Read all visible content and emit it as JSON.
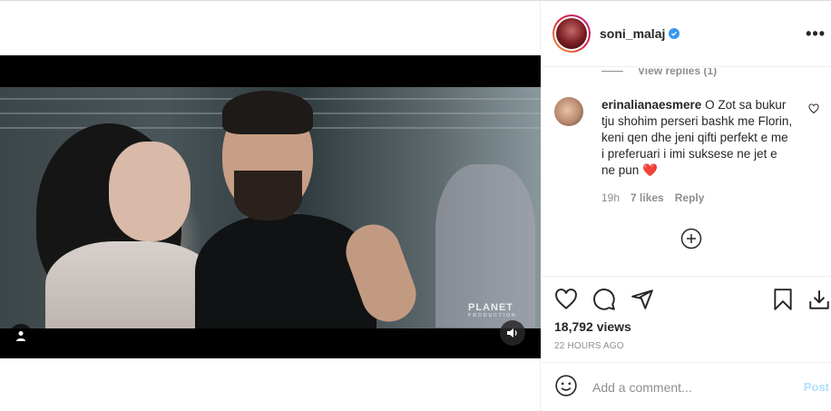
{
  "post": {
    "username": "soni_malaj",
    "verified": true,
    "more_icon": "more-horizontal-icon",
    "media": {
      "watermark_brand": "PLANET",
      "watermark_sub": "PRODUCTION",
      "sound_icon": "speaker-icon",
      "tag_icon": "user-tag-icon"
    },
    "comments": {
      "view_replies": "View replies (1)",
      "items": [
        {
          "username": "erinalianaesmere",
          "text": "O Zot sa bukur tju shohim perseri bashk me Florin, keni qen dhe jeni qifti perfekt e me i preferuari i imi suksese ne jet e ne pun",
          "emoji": "❤️",
          "age": "19h",
          "likes": "7 likes",
          "reply_label": "Reply"
        }
      ],
      "load_more_icon": "plus-circle-icon"
    },
    "actions": {
      "like_icon": "heart-icon",
      "comment_icon": "comment-icon",
      "share_icon": "send-icon",
      "save_icon": "bookmark-icon",
      "download_icon": "download-icon"
    },
    "views": "18,792 views",
    "timestamp": "22 HOURS AGO",
    "add_comment": {
      "placeholder": "Add a comment...",
      "post_label": "Post",
      "emoji_icon": "smiley-icon"
    }
  }
}
